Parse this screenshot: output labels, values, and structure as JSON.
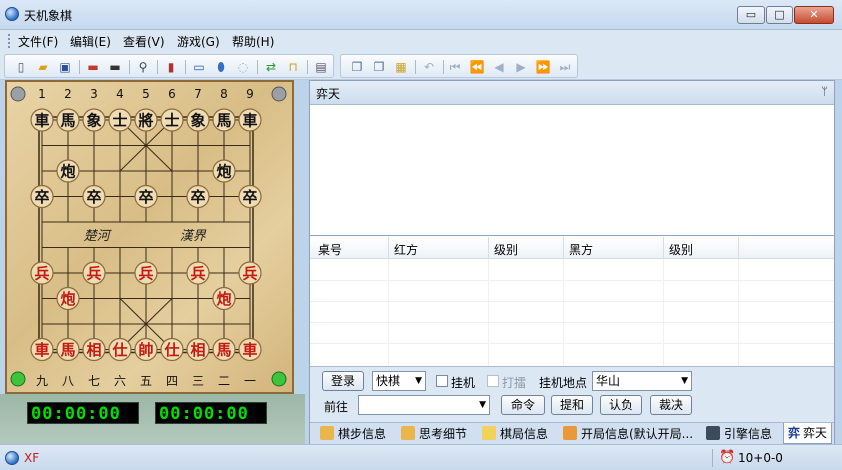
{
  "window": {
    "title": "天机象棋",
    "buttons": {
      "minimize": "▭",
      "maximize": "□",
      "close": "✕"
    }
  },
  "menu": [
    "文件(F)",
    "编辑(E)",
    "查看(V)",
    "游戏(G)",
    "帮助(H)"
  ],
  "toolbar_icons": [
    "new-file-icon",
    "open-folder-icon",
    "save-icon",
    "red-monitor-icon",
    "black-monitor-icon",
    "search-icon",
    "clipboard-icon",
    "window-icon",
    "mic-icon",
    "refresh-disabled-icon",
    "green-arrows-icon",
    "lock-icon",
    "printer-icon",
    "copy-icon",
    "copy2-icon",
    "paste-icon",
    "undo-icon",
    "first-icon",
    "prev-fast-icon",
    "prev-icon",
    "next-icon",
    "next-fast-icon",
    "last-icon"
  ],
  "board": {
    "top_numbers": [
      "1",
      "2",
      "3",
      "4",
      "5",
      "6",
      "7",
      "8",
      "9"
    ],
    "bottom_numbers": [
      "九",
      "八",
      "七",
      "六",
      "五",
      "四",
      "三",
      "二",
      "一"
    ],
    "river_left": "楚河",
    "river_right": "漢界",
    "black_back_row": [
      "車",
      "馬",
      "象",
      "士",
      "將",
      "士",
      "象",
      "馬",
      "車"
    ],
    "black_cannon": "炮",
    "black_pawn": "卒",
    "red_back_row": [
      "車",
      "馬",
      "相",
      "仕",
      "帥",
      "仕",
      "相",
      "馬",
      "車"
    ],
    "red_cannon": "炮",
    "red_pawn": "兵",
    "colors": {
      "red": "#c41a10",
      "black": "#111111",
      "piece_face": "#efdcb4"
    }
  },
  "clocks": {
    "left": {
      "digits": "00:00:00",
      "display": "00:00:00"
    },
    "right": {
      "display": "00:00:00"
    }
  },
  "chat": {
    "title": "弈天",
    "pin": "ᛘ"
  },
  "table": {
    "columns": [
      "桌号",
      "红方",
      "级别",
      "黑方",
      "级别"
    ]
  },
  "controls": {
    "login": "登录",
    "mode": "快棋",
    "hangup_label": "挂机",
    "watch_label": "打擂",
    "location_label": "挂机地点",
    "location_value": "华山",
    "goto_label": "前往",
    "goto_value": "",
    "command": "命令",
    "draw": "提和",
    "resign": "认负",
    "judge": "裁决"
  },
  "tabs": [
    "棋步信息",
    "思考细节",
    "棋局信息",
    "开局信息(默认开局...",
    "引擎信息",
    "弈天"
  ],
  "status": {
    "left": "XF",
    "timer": "10+0-0"
  }
}
